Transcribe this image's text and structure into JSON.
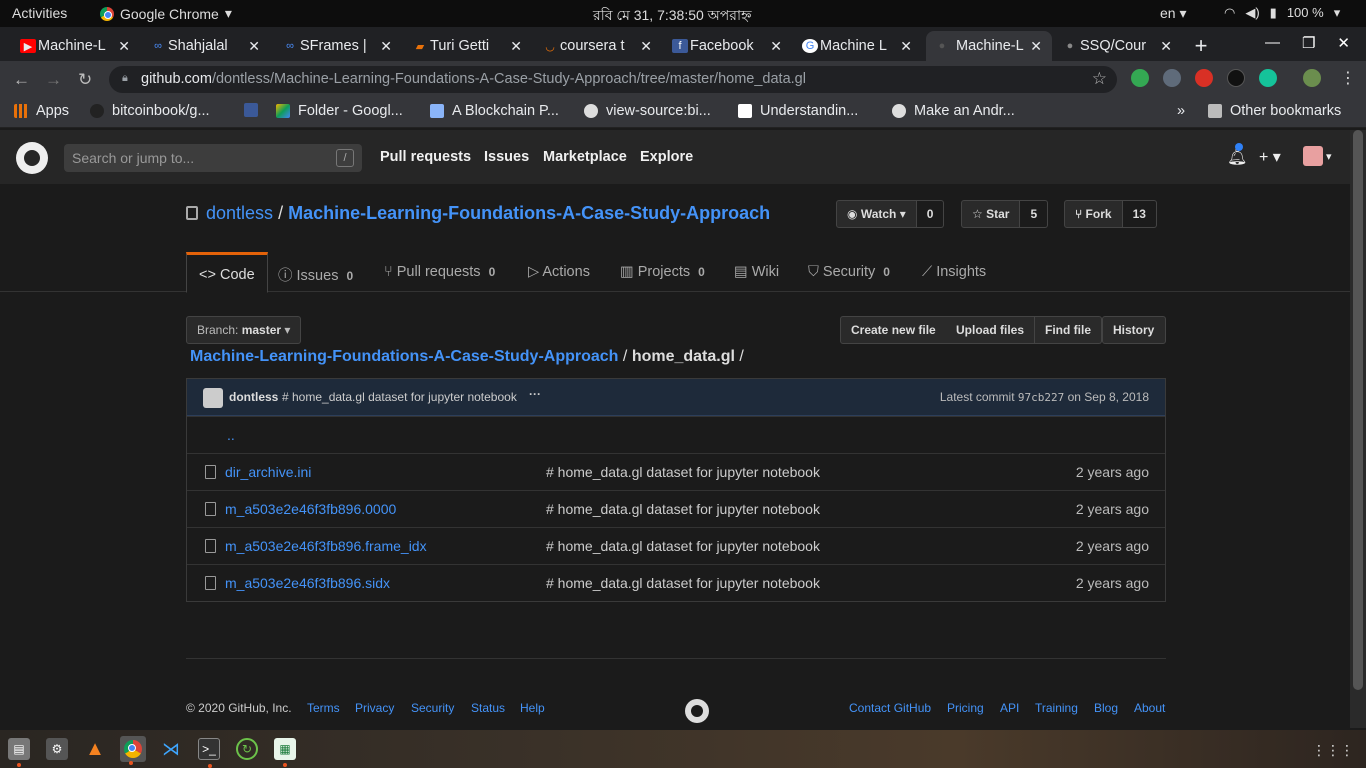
{
  "system": {
    "activities": "Activities",
    "app_name": "Google Chrome",
    "clock": "রবি মে 31,  7:38:50 অপরাহ্ন",
    "lang": "en",
    "battery": "100 %"
  },
  "tabs": [
    {
      "title": "Machine-L",
      "icon_color": "#ff0000"
    },
    {
      "title": "Shahjalal",
      "icon_color": "#4a8cf7"
    },
    {
      "title": "SFrames |",
      "icon_color": "#4a8cf7"
    },
    {
      "title": "Turi Getti",
      "icon_color": "#e8710a"
    },
    {
      "title": "coursera t",
      "icon_color": "#e8710a"
    },
    {
      "title": "Facebook",
      "icon_color": "#3b5998"
    },
    {
      "title": "Machine L",
      "icon_color": "#4285f4"
    },
    {
      "title": "Machine-L",
      "icon_color": "#444"
    },
    {
      "title": "SSQ/Cour",
      "icon_color": "#444"
    }
  ],
  "address": {
    "host": "github.com",
    "path": "/dontless/Machine-Learning-Foundations-A-Case-Study-Approach/tree/master/home_data.gl"
  },
  "bookmarks": [
    {
      "label": "Apps",
      "icon": "apps-grid-icon",
      "color": "#e8710a"
    },
    {
      "label": "bitcoinbook/g...",
      "icon": "github-icon",
      "color": "#222"
    },
    {
      "label": "",
      "icon": "facebook-icon",
      "color": "#3b5998"
    },
    {
      "label": "Folder - Googl...",
      "icon": "google-drive-icon",
      "color": "#0f9d58"
    },
    {
      "label": "A Blockchain P...",
      "icon": "document-icon",
      "color": "#8ab4f8"
    },
    {
      "label": "view-source:bi...",
      "icon": "globe-icon",
      "color": "#ddd"
    },
    {
      "label": "Understandin...",
      "icon": "medium-icon",
      "color": "#fff"
    },
    {
      "label": "Make an Andr...",
      "icon": "globe-icon",
      "color": "#ddd"
    }
  ],
  "other_bookmarks": "Other bookmarks",
  "github": {
    "search_placeholder": "Search or jump to...",
    "search_key": "/",
    "nav": [
      "Pull requests",
      "Issues",
      "Marketplace",
      "Explore"
    ],
    "owner": "dontless",
    "separator": "/",
    "repo": "Machine-Learning-Foundations-A-Case-Study-Approach",
    "watch": {
      "label": "Watch",
      "count": "0"
    },
    "star": {
      "label": "Star",
      "count": "5"
    },
    "fork": {
      "label": "Fork",
      "count": "13"
    },
    "repo_tabs": [
      {
        "label": "Code",
        "count": ""
      },
      {
        "label": "Issues",
        "count": "0"
      },
      {
        "label": "Pull requests",
        "count": "0"
      },
      {
        "label": "Actions",
        "count": ""
      },
      {
        "label": "Projects",
        "count": "0"
      },
      {
        "label": "Wiki",
        "count": ""
      },
      {
        "label": "Security",
        "count": "0"
      },
      {
        "label": "Insights",
        "count": ""
      }
    ],
    "branch_label": "Branch:",
    "branch": "master",
    "file_buttons": [
      "Create new file",
      "Upload files",
      "Find file",
      "History"
    ],
    "crumb_repo": "Machine-Learning-Foundations-A-Case-Study-Approach",
    "crumb_sep": "/",
    "crumb_dir": "home_data.gl",
    "crumb_tail": "/",
    "commit": {
      "author": "dontless",
      "message": "# home_data.gl dataset for jupyter notebook",
      "dots": "···",
      "latest": "Latest commit",
      "sha": "97cb227",
      "date": "on Sep 8, 2018"
    },
    "parent": "..",
    "files": [
      {
        "name": "dir_archive.ini",
        "message": "# home_data.gl dataset for jupyter notebook",
        "age": "2 years ago"
      },
      {
        "name": "m_a503e2e46f3fb896.0000",
        "message": "# home_data.gl dataset for jupyter notebook",
        "age": "2 years ago"
      },
      {
        "name": "m_a503e2e46f3fb896.frame_idx",
        "message": "# home_data.gl dataset for jupyter notebook",
        "age": "2 years ago"
      },
      {
        "name": "m_a503e2e46f3fb896.sidx",
        "message": "# home_data.gl dataset for jupyter notebook",
        "age": "2 years ago"
      }
    ],
    "footer": {
      "copyright": "© 2020 GitHub, Inc.",
      "left_links": [
        "Terms",
        "Privacy",
        "Security",
        "Status",
        "Help"
      ],
      "right_links": [
        "Contact GitHub",
        "Pricing",
        "API",
        "Training",
        "Blog",
        "About"
      ]
    }
  },
  "colors": {
    "link": "#4493f8",
    "accent_tab": "#e36209",
    "background": "#1b1b1b"
  }
}
